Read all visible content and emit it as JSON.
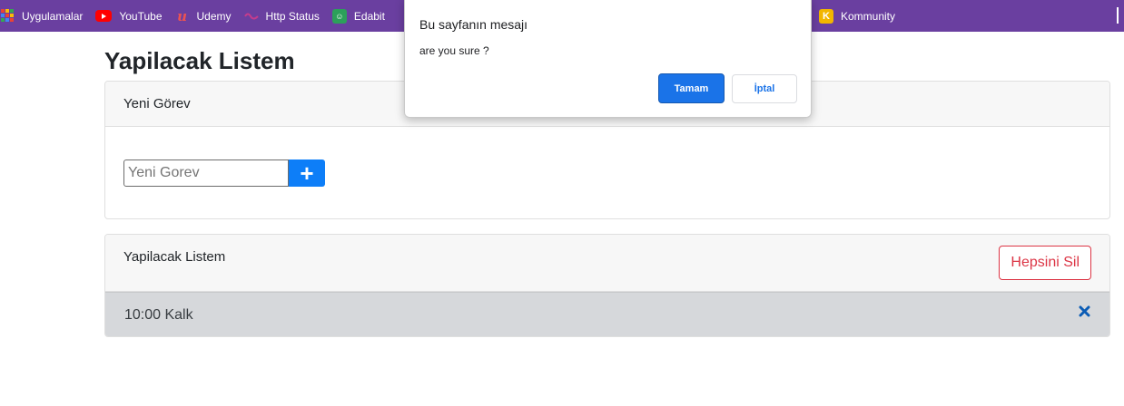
{
  "bookmarks": {
    "items": [
      {
        "label": "Uygulamalar",
        "icon": "apps-grid-icon"
      },
      {
        "label": "YouTube",
        "icon": "youtube-icon"
      },
      {
        "label": "Udemy",
        "icon": "udemy-icon"
      },
      {
        "label": "Http Status",
        "icon": "http-status-icon"
      },
      {
        "label": "Edabit",
        "icon": "edabit-icon"
      },
      {
        "label": "Kommunity",
        "icon": "kommunity-icon"
      }
    ],
    "bar_color": "#6a3fa0"
  },
  "page": {
    "title": "Yapilacak Listem"
  },
  "new_task_card": {
    "header": "Yeni Görev",
    "input_placeholder": "Yeni Gorev",
    "add_button_label": "+"
  },
  "todo_card": {
    "header": "Yapilacak Listem",
    "clear_button_label": "Hepsini Sil",
    "items": [
      {
        "text": "10:00 Kalk",
        "delete_icon": "close-icon"
      }
    ]
  },
  "dialog": {
    "title": "Bu sayfanın mesajı",
    "message": "are you sure ?",
    "ok_label": "Tamam",
    "cancel_label": "İptal"
  },
  "colors": {
    "primary": "#0d7ef8",
    "danger": "#dc3545",
    "dialog_primary": "#1a73e8",
    "list_item_bg": "#d6d8db"
  }
}
